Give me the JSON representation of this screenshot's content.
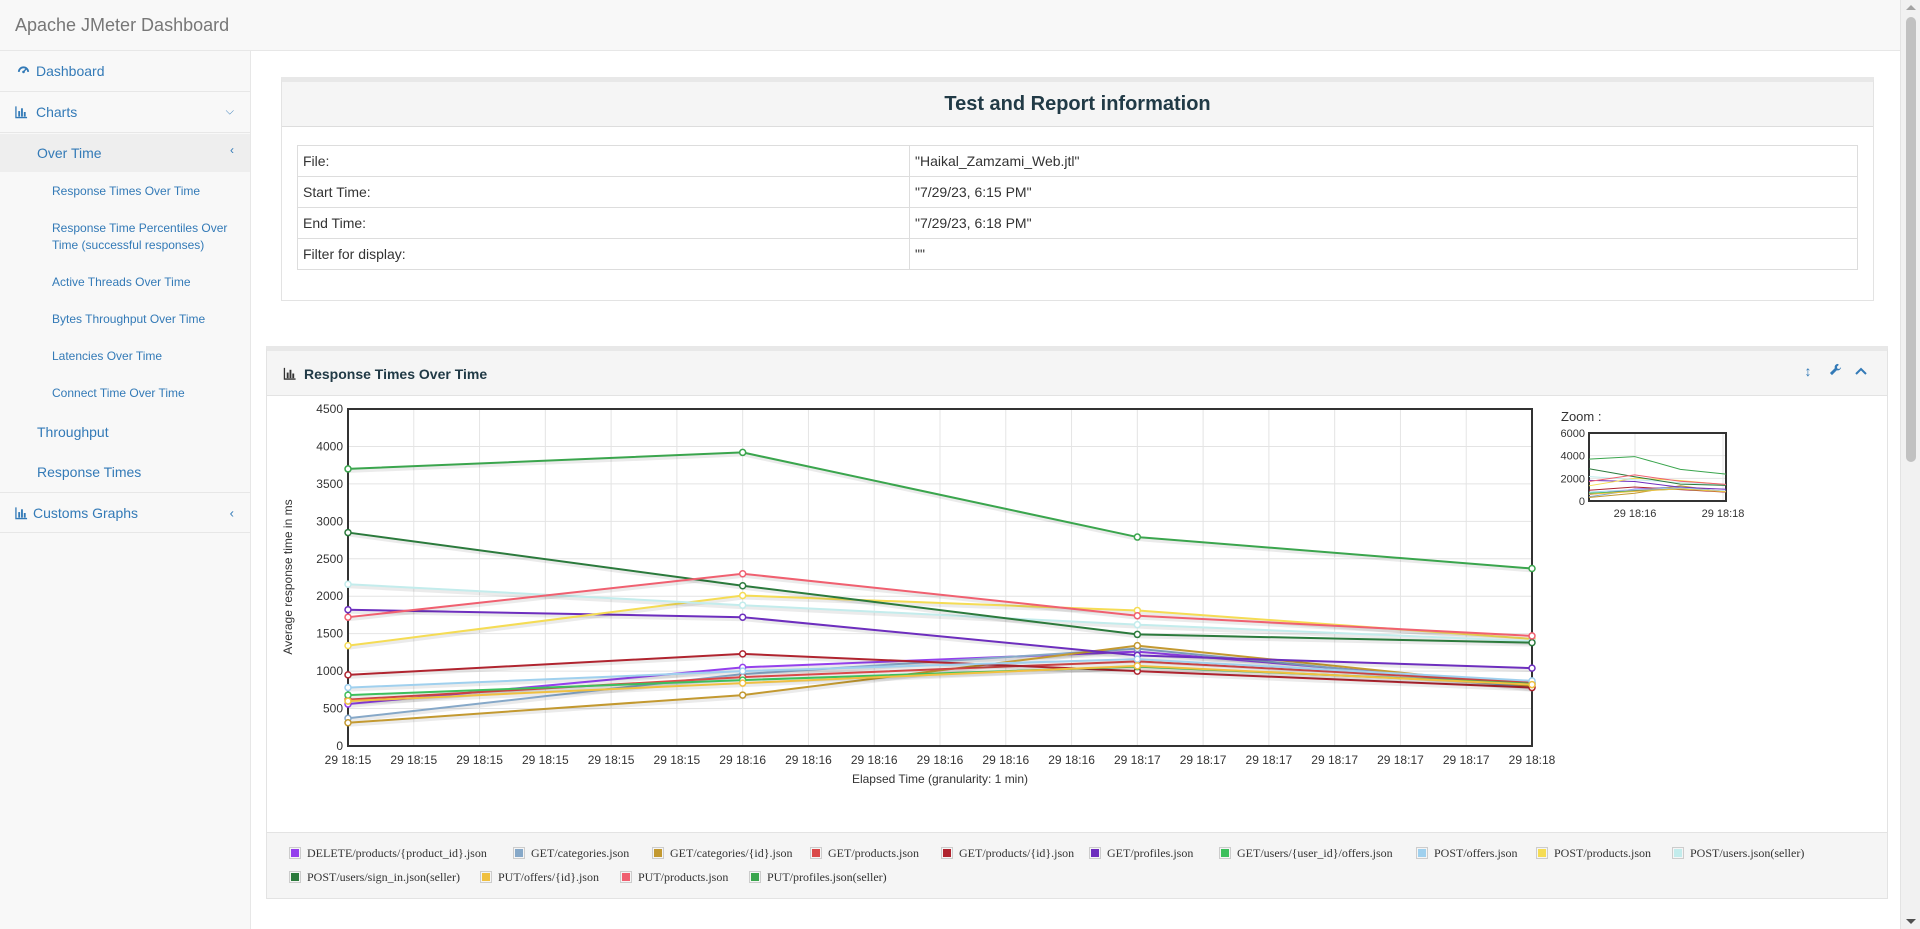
{
  "app": {
    "title": "Apache JMeter Dashboard"
  },
  "sidebar": {
    "dashboard": "Dashboard",
    "charts": "Charts",
    "over_time": "Over Time",
    "over_time_items": [
      "Response Times Over Time",
      "Response Time Percentiles Over Time (successful responses)",
      "Active Threads Over Time",
      "Bytes Throughput Over Time",
      "Latencies Over Time",
      "Connect Time Over Time"
    ],
    "throughput": "Throughput",
    "response_times": "Response Times",
    "customs_graphs": "Customs Graphs"
  },
  "info": {
    "title": "Test and Report information",
    "rows": [
      {
        "key": "File:",
        "value": "\"Haikal_Zamzami_Web.jtl\""
      },
      {
        "key": "Start Time:",
        "value": "\"7/29/23, 6:15 PM\""
      },
      {
        "key": "End Time:",
        "value": "\"7/29/23, 6:18 PM\""
      },
      {
        "key": "Filter for display:",
        "value": "\"\""
      }
    ]
  },
  "chart_panel": {
    "title": "Response Times Over Time",
    "zoom_label": "Zoom :",
    "tools": [
      "expand-vertical-icon",
      "wrench-icon",
      "chevron-up-icon"
    ]
  },
  "chart_data": {
    "type": "line",
    "xlabel": "Elapsed Time (granularity: 1 min)",
    "ylabel": "Average response time in ms",
    "ylim": [
      0,
      4500
    ],
    "yticks": [
      0,
      500,
      1000,
      1500,
      2000,
      2500,
      3000,
      3500,
      4000,
      4500
    ],
    "x": [
      "29 18:15",
      "29 18:16",
      "29 18:17",
      "29 18:18"
    ],
    "x_tick_labels": [
      "29 18:15",
      "29 18:15",
      "29 18:15",
      "29 18:15",
      "29 18:15",
      "29 18:15",
      "29 18:16",
      "29 18:16",
      "29 18:16",
      "29 18:16",
      "29 18:16",
      "29 18:16",
      "29 18:17",
      "29 18:17",
      "29 18:17",
      "29 18:17",
      "29 18:17",
      "29 18:17",
      "29 18:18"
    ],
    "grid": true,
    "legend_position": "bottom",
    "series": [
      {
        "name": "DELETE/products/{product_id}.json",
        "color": "#9440ed",
        "values": [
          560,
          1050,
          1260,
          820
        ]
      },
      {
        "name": "GET/categories.json",
        "color": "#86a8c8",
        "values": [
          370,
          960,
          1300,
          780
        ]
      },
      {
        "name": "GET/categories/{id}.json",
        "color": "#c39930",
        "values": [
          310,
          680,
          1340,
          800
        ]
      },
      {
        "name": "GET/products.json",
        "color": "#da4949",
        "values": [
          620,
          920,
          1130,
          850
        ]
      },
      {
        "name": "GET/products/{id}.json",
        "color": "#b0242f",
        "values": [
          950,
          1230,
          1000,
          780
        ]
      },
      {
        "name": "GET/profiles.json",
        "color": "#6d2ebe",
        "values": [
          1820,
          1720,
          1210,
          1040
        ]
      },
      {
        "name": "GET/users/{user_id}/offers.json",
        "color": "#3dbf5c",
        "values": [
          680,
          880,
          1060,
          830
        ]
      },
      {
        "name": "POST/offers.json",
        "color": "#9fd0ee",
        "values": [
          780,
          1000,
          1160,
          870
        ]
      },
      {
        "name": "POST/products.json",
        "color": "#f5dc54",
        "values": [
          1340,
          2010,
          1810,
          1430
        ]
      },
      {
        "name": "POST/users.json(seller)",
        "color": "#c3ecec",
        "values": [
          2160,
          1880,
          1620,
          1400
        ]
      },
      {
        "name": "POST/users/sign_in.json(seller)",
        "color": "#2b7a3c",
        "values": [
          2850,
          2140,
          1490,
          1380
        ]
      },
      {
        "name": "PUT/offers/{id}.json",
        "color": "#f0c040",
        "values": [
          600,
          840,
          1070,
          820
        ]
      },
      {
        "name": "PUT/products.json",
        "color": "#f06070",
        "values": [
          1720,
          2300,
          1740,
          1470
        ]
      },
      {
        "name": "PUT/profiles.json(seller)",
        "color": "#3aa54d",
        "values": [
          3700,
          3920,
          2790,
          2370
        ]
      }
    ],
    "zoom": {
      "yticks": [
        0,
        2000,
        4000,
        6000
      ],
      "ylim": [
        0,
        6000
      ],
      "xticks": [
        "29 18:16",
        "29 18:18"
      ]
    }
  }
}
